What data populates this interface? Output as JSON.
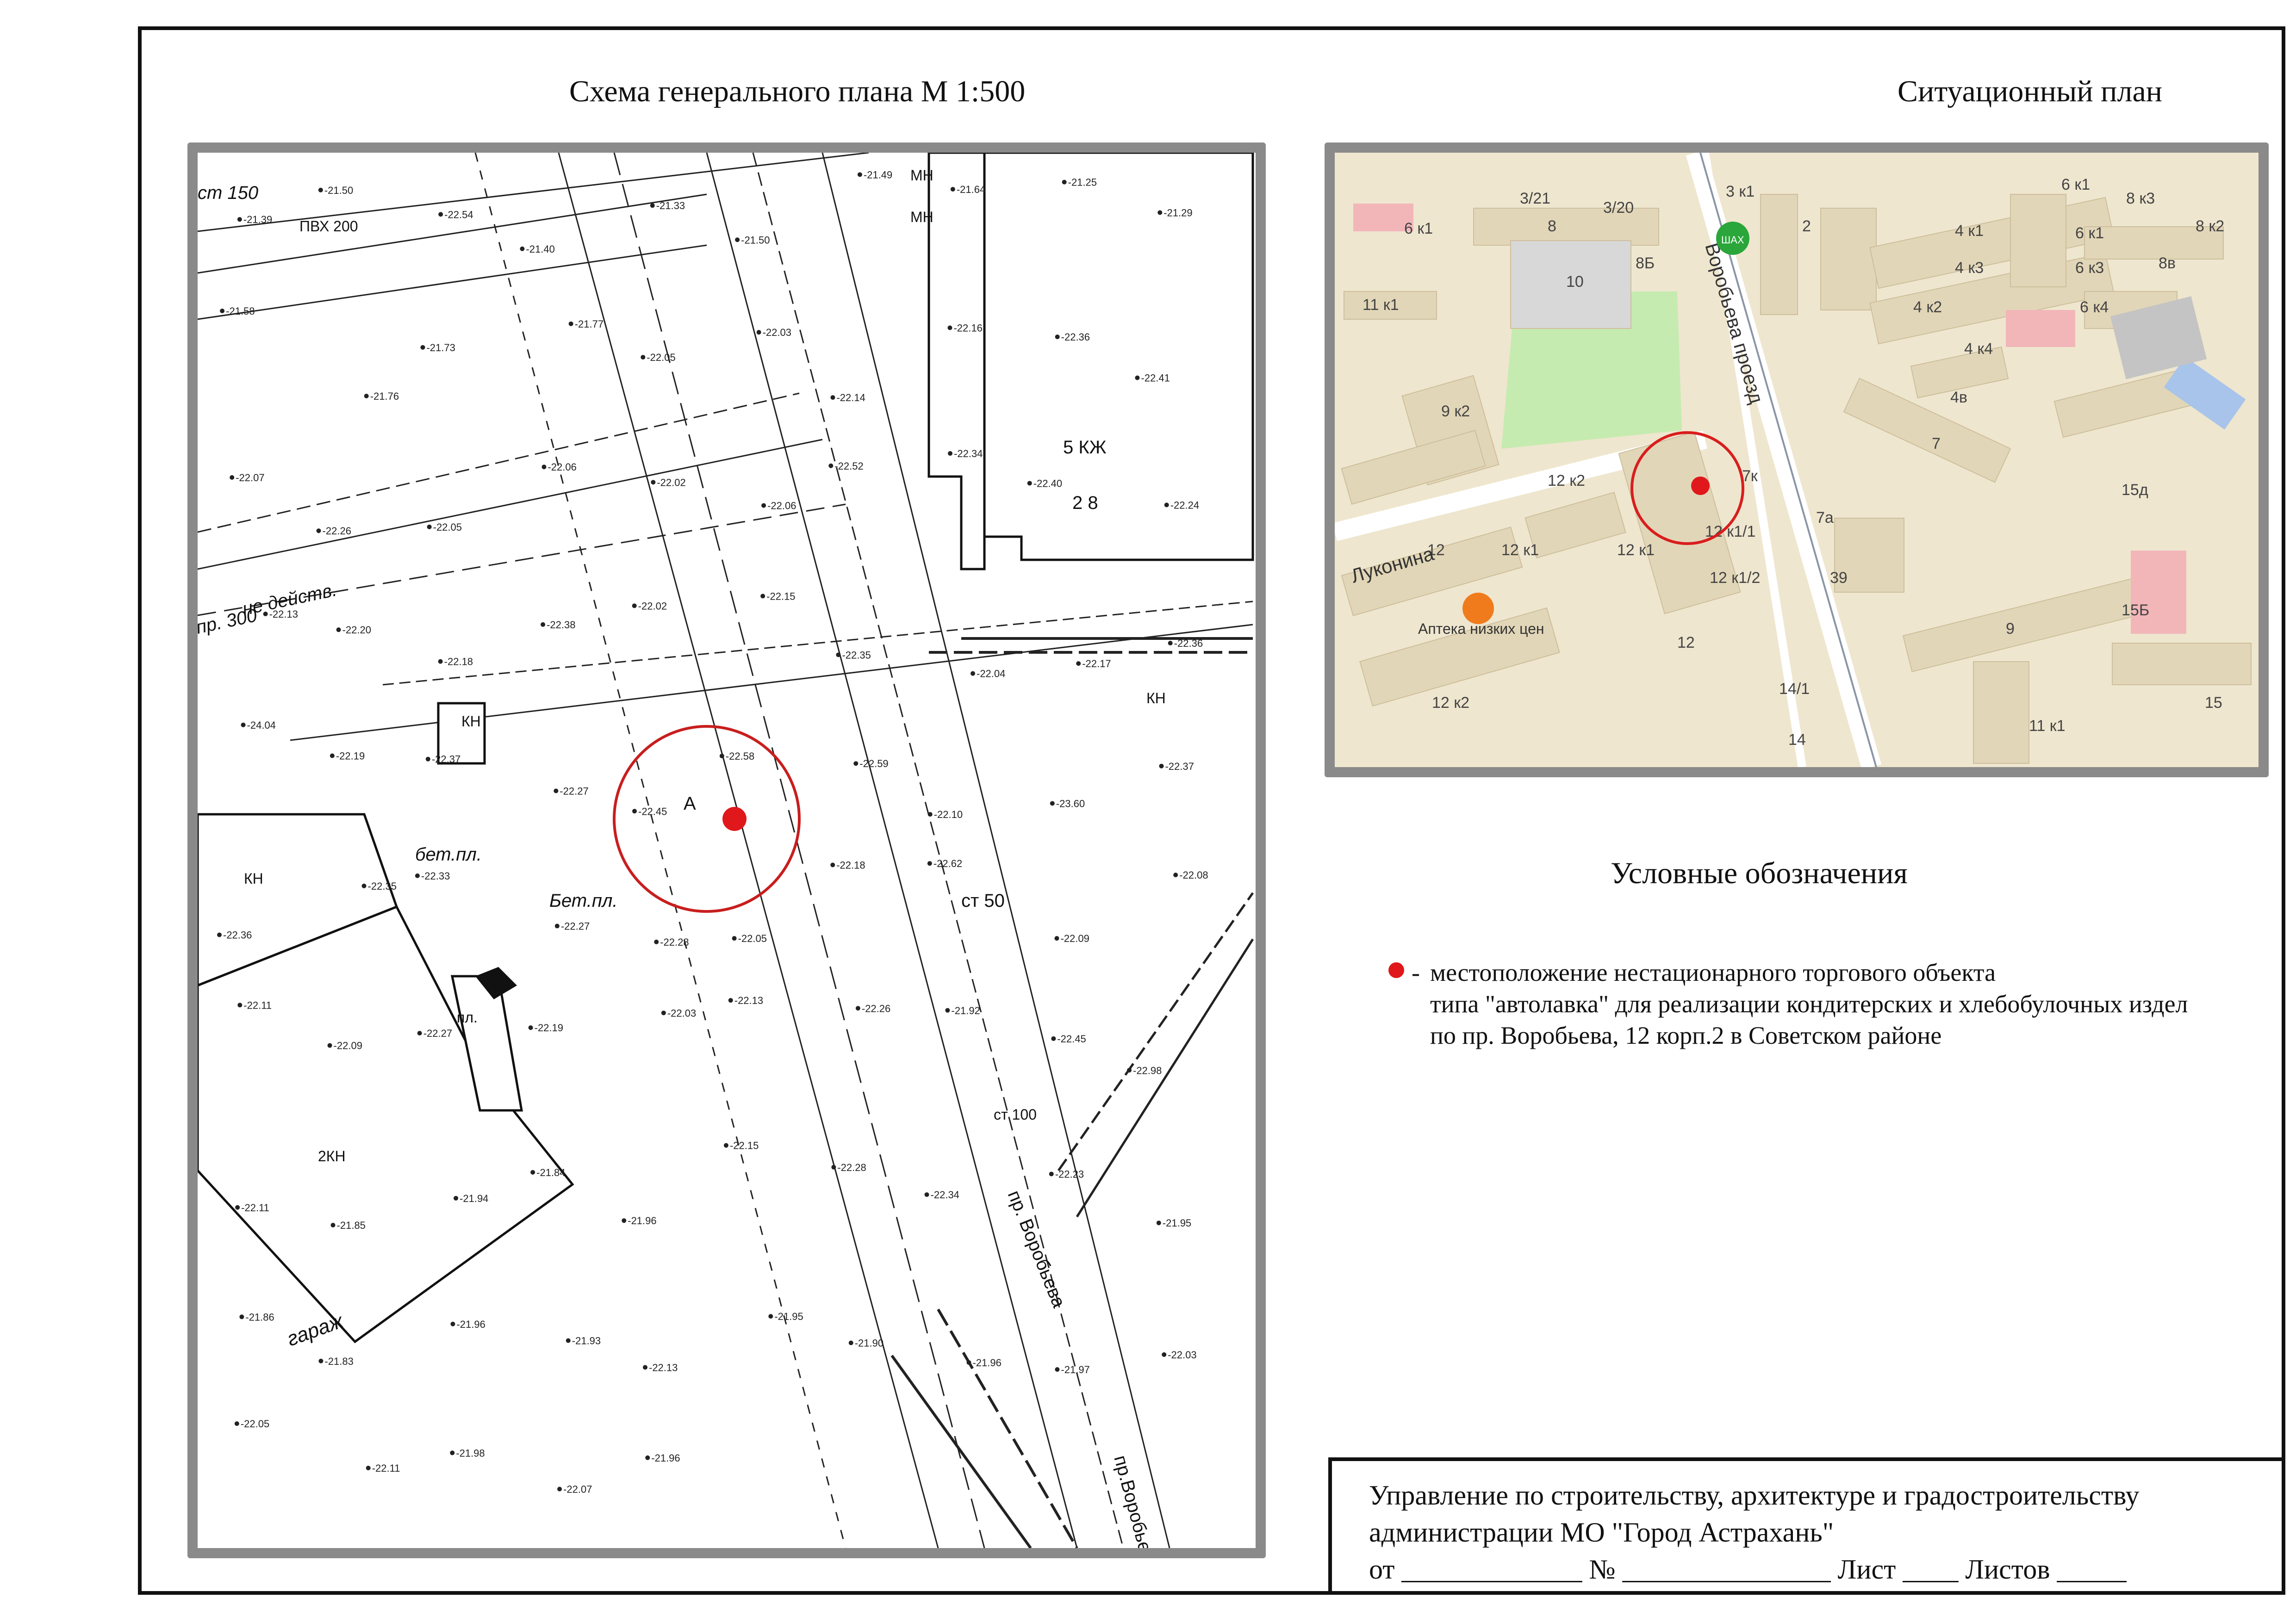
{
  "left_title": "Схема генерального плана М 1:500",
  "right_title": "Ситуационный план",
  "legend": {
    "title": "Условные обозначения",
    "marker_color": "#e0181b",
    "dash": "-",
    "lines": [
      "местоположение нестационарного торгового объекта",
      "типа \"автолавка\" для реализации кондитерских и хлебобулочных издел",
      "по пр. Воробьева, 12 корп.2 в Советском районе"
    ]
  },
  "stamp": {
    "line1": "Управление по строительству, архитектуре и градостроительству",
    "line2": "администрации МО \"Город Астрахань\"",
    "line3": "от _____________ № _______________ Лист ____ Листов _____"
  },
  "general_plan": {
    "labels": [
      "5 КЖ",
      "2 8",
      "КН",
      "2КН",
      "КН",
      "КН",
      "МН",
      "МН",
      "пр. Воробьева",
      "пр.Воробьева",
      "бет.пл.",
      "Бет.пл.",
      "гараж",
      "пл.",
      "ст 50",
      "ПВХ 200",
      "ст 150",
      "ст 100",
      "не действ.",
      "пр. 300",
      "А"
    ],
    "elevations": [
      "-21.39",
      "-21.50",
      "-22.54",
      "-21.40",
      "-21.33",
      "-21.50",
      "-21.49",
      "-21.64",
      "-21.25",
      "-21.29",
      "-21.58",
      "-21.76",
      "-21.73",
      "-21.77",
      "-22.05",
      "-22.03",
      "-22.14",
      "-22.16",
      "-22.36",
      "-22.41",
      "-22.07",
      "-22.26",
      "-22.05",
      "-22.06",
      "-22.02",
      "-22.06",
      "-22.52",
      "-22.34",
      "-22.40",
      "-22.24",
      "-22.13",
      "-22.20",
      "-22.18",
      "-22.38",
      "-22.02",
      "-22.15",
      "-22.35",
      "-22.04",
      "-22.17",
      "-22.36",
      "-24.04",
      "-22.19",
      "-22.37",
      "-22.27",
      "-22.45",
      "-22.58",
      "-22.59",
      "-22.10",
      "-23.60",
      "-22.37",
      "-22.36",
      "-22.35",
      "-22.33",
      "-22.27",
      "-22.28",
      "-22.05",
      "-22.18",
      "-22.62",
      "-22.09",
      "-22.08",
      "-22.11",
      "-22.09",
      "-22.27",
      "-22.19",
      "-22.03",
      "-22.13",
      "-22.26",
      "-21.92",
      "-22.45",
      "-22.98",
      "-22.11",
      "-21.85",
      "-21.94",
      "-21.84",
      "-21.96",
      "-22.15",
      "-22.28",
      "-22.34",
      "-22.23",
      "-21.95",
      "-21.86",
      "-21.83",
      "-21.96",
      "-21.93",
      "-22.13",
      "-21.95",
      "-21.90",
      "-21.96",
      "-21.97",
      "-22.03",
      "-22.05",
      "-22.11",
      "-21.98",
      "-22.07",
      "-21.96"
    ]
  },
  "situation_plan": {
    "labels": [
      "3/21",
      "3/20",
      "3 к1",
      "2",
      "6 к1",
      "4 к1",
      "6 к1",
      "8 к3",
      "8 к2",
      "6 к1",
      "8",
      "8Б",
      "11 к1",
      "10",
      "4 к3",
      "6 к3",
      "8в",
      "4 к2",
      "6 к4",
      "4 к4",
      "4в",
      "9 к2",
      "7",
      "15д",
      "12 к2",
      "7к",
      "12 к1",
      "7а",
      "12 к1/1",
      "12 к1/2",
      "39",
      "12 к1",
      "12",
      "15Б",
      "9",
      "12",
      "14/1",
      "12 к2",
      "14",
      "11 к1",
      "15",
      "Лукoнина",
      "Воробьева проезд",
      "Аптека низких цен",
      "ШАХ"
    ],
    "street_color": "#ffffff",
    "block_color": "#efe6cf",
    "building_color": "#e2d6b8",
    "park_color": "#c6ebb0"
  }
}
